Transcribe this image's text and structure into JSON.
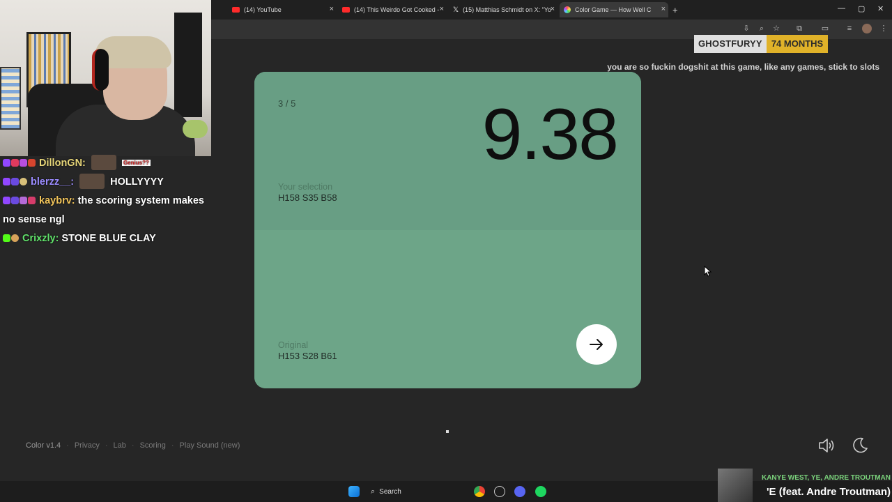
{
  "browser": {
    "tabs": [
      {
        "title": "(14) YouTube",
        "favicon_color": "#ff2b2b"
      },
      {
        "title": "(14) This Weirdo Got Cooked -",
        "favicon_color": "#ff2b2b"
      },
      {
        "title": "(15) Matthias Schmidt on X: \"Yo",
        "favicon_color": "#e8e8e8"
      },
      {
        "title": "Color Game — How Well C",
        "favicon_color": "#c86dd7",
        "active": true
      }
    ],
    "new_tab_label": "+"
  },
  "chat": {
    "messages": [
      {
        "user": "DillonGN:",
        "user_color": "#e8d77a",
        "text": "",
        "emote_label": "Genius??"
      },
      {
        "user": "blerzz__:",
        "user_color": "#9b8cff",
        "text": "HOLLYYYY"
      },
      {
        "user": "kaybrv:",
        "user_color": "#f0c35a",
        "text": "the scoring system makes no sense ngl"
      },
      {
        "user": "Crixzly:",
        "user_color": "#61e36b",
        "text": "STONE BLUE CLAY"
      }
    ]
  },
  "sub_alert": {
    "name": "GHOSTFURYY",
    "months": "74 MONTHS",
    "message": "you are so fuckin dogshit at this game, like any games, stick to slots"
  },
  "game": {
    "round": "3 / 5",
    "score": "9.38",
    "your_selection_label": "Your selection",
    "your_selection_value": "H158 S35 B58",
    "original_label": "Original",
    "original_value": "H153 S28 B61",
    "selection_color": "#689e84",
    "original_color": "#6da588",
    "next_icon": "arrow-right-icon"
  },
  "footer": {
    "brand": "Color v1.4",
    "links": [
      "Privacy",
      "Lab",
      "Scoring",
      "Play Sound (new)"
    ],
    "sound_icon": "speaker-icon",
    "theme_icon": "moon-icon"
  },
  "taskbar": {
    "search_label": "Search"
  },
  "now_playing": {
    "artist": "KANYE WEST, YE, ANDRE TROUTMAN",
    "title": "'E (feat. Andre Troutman)"
  }
}
